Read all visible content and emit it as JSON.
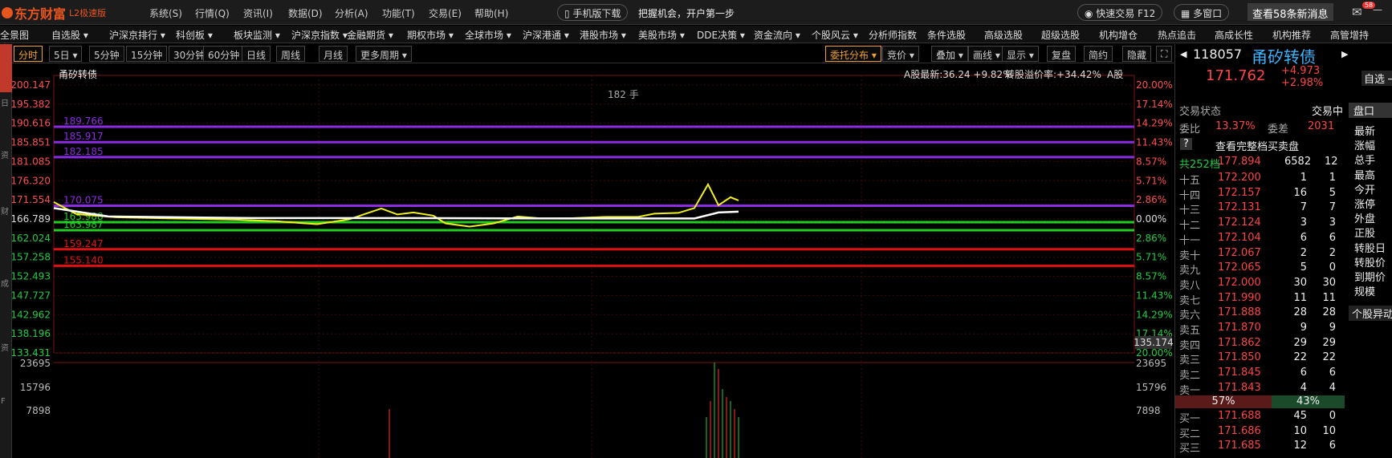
{
  "app": {
    "name": "东方财富",
    "version": "L2极速版"
  },
  "menu": [
    "系统(S)",
    "行情(Q)",
    "资讯(I)",
    "数据(D)",
    "分析(A)",
    "功能(T)",
    "交易(E)",
    "帮助(H)"
  ],
  "mobile_download": "手机版下载",
  "slogan": "把握机会，开户第一步",
  "quick_trade": "快速交易 F12",
  "multi_window": "多窗口",
  "news_button": "查看58条新消息",
  "mail_badge": "58",
  "nav": [
    "全景图",
    "自选股",
    "沪深京排行",
    "科创板",
    "板块监测",
    "沪深京指数",
    "金融期货",
    "期权市场",
    "全球市场",
    "沪深港通",
    "港股市场",
    "美股市场",
    "DDE决策",
    "资金流向",
    "个股风云",
    "分析师指数",
    "条件选股",
    "高级选股",
    "超级选股",
    "机构增仓",
    "热点追击",
    "高成长性",
    "机构推荐",
    "高管增持"
  ],
  "left_strip_active": "分时图",
  "periods": [
    "分时",
    "5日",
    "5分钟",
    "15分钟",
    "30分钟",
    "60分钟",
    "日线",
    "周线",
    "月线",
    "更多周期"
  ],
  "tools": [
    "委托分布",
    "竞价",
    "叠加",
    "画线",
    "显示",
    "复盘",
    "简约",
    "隐藏"
  ],
  "chart": {
    "title": "甬矽转债",
    "volume_label": "182 手",
    "a_share_label": "A股最新:",
    "a_share_price": "36.24",
    "a_share_change": "+9.82%",
    "premium_label": "转股溢价率:",
    "premium_value": "+34.42%",
    "a_tag": "A股",
    "last_marker": "135.174",
    "left_ticks": [
      "200.147",
      "195.382",
      "190.616",
      "185.851",
      "181.085",
      "176.320",
      "171.554",
      "166.789",
      "162.024",
      "157.258",
      "152.493",
      "147.727",
      "142.962",
      "138.196",
      "133.431"
    ],
    "right_ticks": [
      "20.00%",
      "17.14%",
      "14.29%",
      "11.43%",
      "8.57%",
      "5.71%",
      "2.86%",
      "0.00%",
      "2.86%",
      "5.71%",
      "8.57%",
      "11.43%",
      "14.29%",
      "17.14%",
      "20.00%"
    ],
    "vol_ticks": [
      "23695",
      "15796",
      "7898"
    ],
    "hlines": [
      {
        "label": "189.766",
        "color": "#8b2be2"
      },
      {
        "label": "185.917",
        "color": "#8b2be2"
      },
      {
        "label": "182.185",
        "color": "#8b2be2"
      },
      {
        "label": "170.075",
        "color": "#8b2be2"
      },
      {
        "label": "165.988",
        "color": "#22cc22"
      },
      {
        "label": "163.987",
        "color": "#22cc22"
      },
      {
        "label": "159.247",
        "color": "#dd1111"
      },
      {
        "label": "155.140",
        "color": "#dd1111"
      }
    ]
  },
  "quote": {
    "code": "118057",
    "name": "甬矽转债",
    "price": "171.762",
    "change": "+4.973",
    "pct": "+2.98%",
    "add": "自选",
    "status_label": "交易状态",
    "status": "交易中",
    "wb_label": "委比",
    "wb": "13.37%",
    "wc_label": "委差",
    "wc": "2031",
    "full_book": "查看完整档买卖盘",
    "total_levels": "共252档",
    "total_price": "177.894",
    "total_vol": "6582",
    "total_cnt": "12",
    "asks": [
      [
        "十五",
        "172.200",
        "1",
        "1"
      ],
      [
        "十四",
        "172.157",
        "16",
        "5"
      ],
      [
        "十三",
        "172.131",
        "7",
        "7"
      ],
      [
        "十二",
        "172.124",
        "3",
        "3"
      ],
      [
        "十一",
        "172.104",
        "6",
        "6"
      ],
      [
        "卖十",
        "172.067",
        "2",
        "2"
      ],
      [
        "卖九",
        "172.065",
        "5",
        "0"
      ],
      [
        "卖八",
        "172.000",
        "30",
        "30"
      ],
      [
        "卖七",
        "171.990",
        "11",
        "11"
      ],
      [
        "卖六",
        "171.888",
        "28",
        "28"
      ],
      [
        "卖五",
        "171.870",
        "9",
        "9"
      ],
      [
        "卖四",
        "171.862",
        "29",
        "29"
      ],
      [
        "卖三",
        "171.850",
        "22",
        "22"
      ],
      [
        "卖二",
        "171.845",
        "6",
        "6"
      ],
      [
        "卖一",
        "171.843",
        "4",
        "4"
      ]
    ],
    "ask_pct": "57%",
    "bid_pct": "43%",
    "bids": [
      [
        "买一",
        "171.688",
        "45",
        "0"
      ],
      [
        "买二",
        "171.686",
        "10",
        "10"
      ],
      [
        "买三",
        "171.685",
        "12",
        "6"
      ]
    ],
    "side_tabs": [
      "盘口"
    ],
    "side_labels": [
      "最新",
      "涨幅",
      "总手",
      "最高",
      "今开",
      "涨停",
      "外盘",
      "正股",
      "转股日",
      "转股价",
      "到期价",
      "规模"
    ],
    "side_bottom": "个股异动"
  }
}
